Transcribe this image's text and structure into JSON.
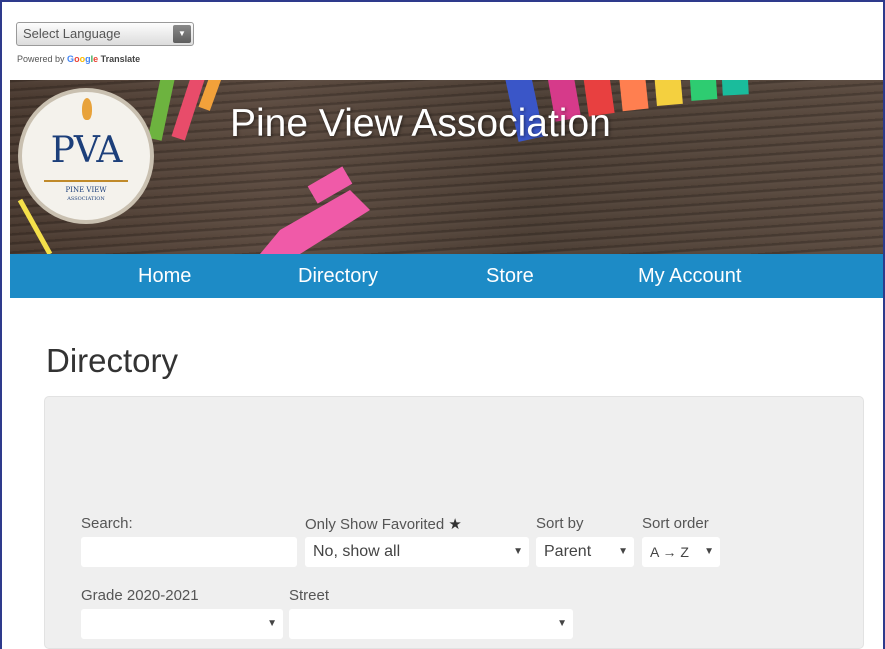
{
  "translate": {
    "select_label": "Select Language",
    "powered_prefix": "Powered by",
    "google": [
      "G",
      "o",
      "o",
      "g",
      "l",
      "e"
    ],
    "translate_word": "Translate"
  },
  "header": {
    "title": "Pine View Association",
    "logo_text": "PVA",
    "logo_sub": "PINE VIEW",
    "logo_sub2": "ASSOCIATION"
  },
  "nav": {
    "items": [
      {
        "label": "Home"
      },
      {
        "label": "Directory"
      },
      {
        "label": "Store"
      },
      {
        "label": "My Account"
      }
    ]
  },
  "page": {
    "title": "Directory"
  },
  "filters": {
    "search_label": "Search:",
    "search_value": "",
    "favorited_label": "Only Show Favorited",
    "favorited_star": "★",
    "favorited_value": "No, show all",
    "sort_by_label": "Sort by",
    "sort_by_value": "Parent",
    "sort_order_label": "Sort order",
    "sort_order_value": "A → Z",
    "grade_label": "Grade 2020-2021",
    "grade_value": "",
    "street_label": "Street",
    "street_value": ""
  },
  "icons": {
    "dropdown": "▼"
  },
  "colors": {
    "nav_bg": "#1d8bc6",
    "frame_border": "#2e3a8c",
    "panel_bg": "#efefef"
  }
}
